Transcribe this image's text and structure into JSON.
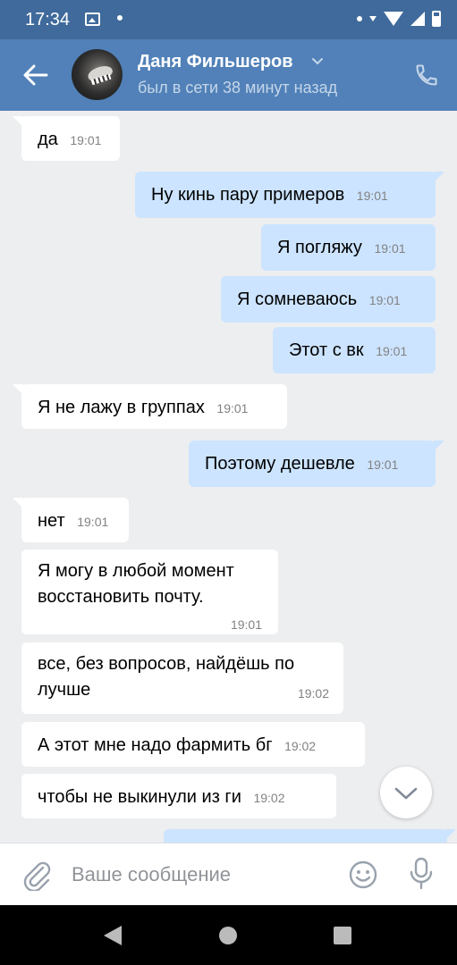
{
  "status_bar": {
    "time": "17:34"
  },
  "header": {
    "name": "Даня Фильшеров",
    "status": "был в сети 38 минут назад"
  },
  "messages": [
    {
      "dir": "in",
      "text": "да",
      "time": "19:01"
    },
    {
      "dir": "out",
      "text": "Ну кинь пару примеров",
      "time": "19:01"
    },
    {
      "dir": "out",
      "text": "Я погляжу",
      "time": "19:01"
    },
    {
      "dir": "out",
      "text": "Я сомневаюсь",
      "time": "19:01"
    },
    {
      "dir": "out",
      "text": "Этот с вк",
      "time": "19:01"
    },
    {
      "dir": "in",
      "text": "Я не лажу в группах",
      "time": "19:01"
    },
    {
      "dir": "out",
      "text": "Поэтому дешевле",
      "time": "19:01"
    },
    {
      "dir": "in",
      "text": "нет",
      "time": "19:01"
    },
    {
      "dir": "in",
      "text": "Я могу в любой момент восстановить почту.",
      "time": "19:01"
    },
    {
      "dir": "in",
      "text": "все, без вопросов, найдёшь по лучше",
      "time": "19:02"
    },
    {
      "dir": "in",
      "text": "А этот мне надо фармить бг",
      "time": "19:02"
    },
    {
      "dir": "in",
      "text": "чтобы не выкинули из ги",
      "time": "19:02"
    },
    {
      "dir": "out",
      "text": "",
      "time": ""
    }
  ],
  "composer": {
    "placeholder": "Ваше сообщение"
  },
  "icons": {
    "back": "arrow-left-icon",
    "call": "phone-icon",
    "chevron": "chevron-down-icon",
    "attach": "paperclip-icon",
    "emoji": "smiley-icon",
    "mic": "microphone-icon",
    "scroll_down": "chevron-down-icon"
  },
  "colors": {
    "header_bg": "#5181b8",
    "statusbar_bg": "#3f6a9b",
    "chat_bg": "#edeef0",
    "incoming_bubble": "#ffffff",
    "outgoing_bubble": "#cce4ff"
  }
}
